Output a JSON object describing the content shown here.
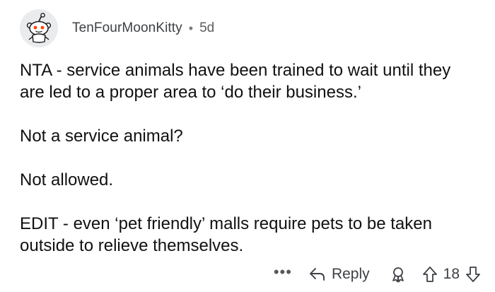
{
  "comment": {
    "author": "TenFourMoonKitty",
    "separator": "•",
    "age": "5d",
    "paragraphs": [
      "NTA - service animals have been trained to wait until they are led to a proper area to ‘do their business.’",
      "Not a service animal?",
      "Not allowed.",
      "EDIT - even ‘pet friendly’ malls require pets to be taken  outside to relieve themselves."
    ],
    "actions": {
      "more_label": "•••",
      "reply_label": "Reply",
      "score": "18"
    }
  },
  "icons": {
    "avatar": "snoo-avatar-icon",
    "reply": "reply-arrow-icon",
    "award": "award-icon",
    "upvote": "upvote-arrow-icon",
    "downvote": "downvote-arrow-icon"
  },
  "colors": {
    "text": "#111111",
    "muted": "#5b5e62",
    "avatar_bg": "#e9ebed",
    "avatar_accent": "#ff4500"
  }
}
